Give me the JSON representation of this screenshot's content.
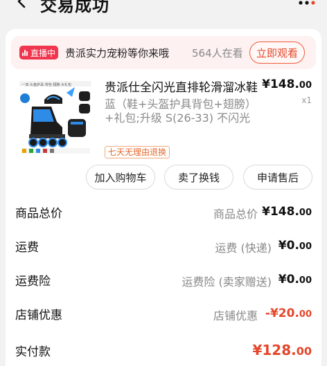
{
  "header": {
    "title": "交易成功",
    "back_icon": "chevron-left-icon",
    "more_icon": "more-dots-icon"
  },
  "live": {
    "badge_label": "直播中",
    "text": "贵派实力宠粉等你来哦",
    "viewers": "564人在看",
    "watch_button": "立即观看"
  },
  "product": {
    "title": "贵派仕全闪光直排轮滑溜冰鞋",
    "spec": "蓝（鞋+头盔护具背包+翅膀）+礼包;升级 S(26-33) 不闪光",
    "price_main": "¥148.",
    "price_cents": "00",
    "quantity": "x1",
    "return_tag": "七天无理由退换"
  },
  "actions": {
    "add_cart": "加入购物车",
    "resell": "卖了换钱",
    "after_sale": "申请售后"
  },
  "summary": {
    "rows": [
      {
        "label": "商品总价",
        "desc": "商品总价",
        "value_main": "¥148.",
        "value_cents": "00"
      },
      {
        "label": "运费",
        "desc": "运费 (快递)",
        "value_main": "¥0.",
        "value_cents": "00"
      },
      {
        "label": "运费险",
        "desc": "运费险 (卖家赠送)",
        "value_main": "¥0.",
        "value_cents": "00"
      },
      {
        "label": "店铺优惠",
        "desc": "店铺优惠",
        "value_main": "-¥20.",
        "value_cents": "00"
      },
      {
        "label": "实付款",
        "value_main": "¥128.",
        "value_cents": "00"
      }
    ]
  },
  "colors": {
    "accent_red": "#e5462b",
    "live_badge": "#f0354e",
    "background": "#f2f2f2"
  }
}
